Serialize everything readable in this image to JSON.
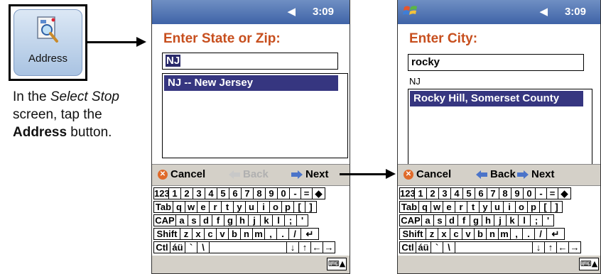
{
  "address_button": {
    "label": "Address",
    "icon": "address-magnifier-icon"
  },
  "instruction": {
    "line1_plain": "In the ",
    "line1_italic": "Select Stop",
    "line2": "screen, tap the",
    "line3_bold": "Address",
    "line3_plain": " button."
  },
  "screen1": {
    "status": {
      "speaker": "◀€",
      "time": "3:09"
    },
    "prompt": "Enter State or Zip:",
    "field_value": "NJ",
    "list_items": [
      "NJ -- New Jersey"
    ],
    "commands": {
      "cancel": "Cancel",
      "back": "Back",
      "next": "Next"
    }
  },
  "screen2": {
    "status": {
      "speaker": "◀€",
      "time": "3:09"
    },
    "prompt": "Enter City:",
    "field_value": "rocky",
    "state_label": "NJ",
    "list_items": [
      "Rocky Hill, Somerset County"
    ],
    "commands": {
      "cancel": "Cancel",
      "back": "Back",
      "next": "Next"
    }
  },
  "keyboard": {
    "row1": [
      "123",
      "1",
      "2",
      "3",
      "4",
      "5",
      "6",
      "7",
      "8",
      "9",
      "0",
      "-",
      "=",
      "◆"
    ],
    "row2": [
      "Tab",
      "q",
      "w",
      "e",
      "r",
      "t",
      "y",
      "u",
      "i",
      "o",
      "p",
      "[",
      "]"
    ],
    "row3": [
      "CAP",
      "a",
      "s",
      "d",
      "f",
      "g",
      "h",
      "j",
      "k",
      "l",
      ";",
      "'"
    ],
    "row4": [
      "Shift",
      "z",
      "x",
      "c",
      "v",
      "b",
      "n",
      "m",
      ",",
      ".",
      "/",
      "↵"
    ],
    "row5": [
      "Ctl",
      "áü",
      "`",
      "\\",
      "",
      "↓",
      "↑",
      "←",
      "→"
    ]
  },
  "colors": {
    "titlebar": "#4a6db0",
    "prompt": "#c74f1e",
    "selection": "#363680"
  }
}
